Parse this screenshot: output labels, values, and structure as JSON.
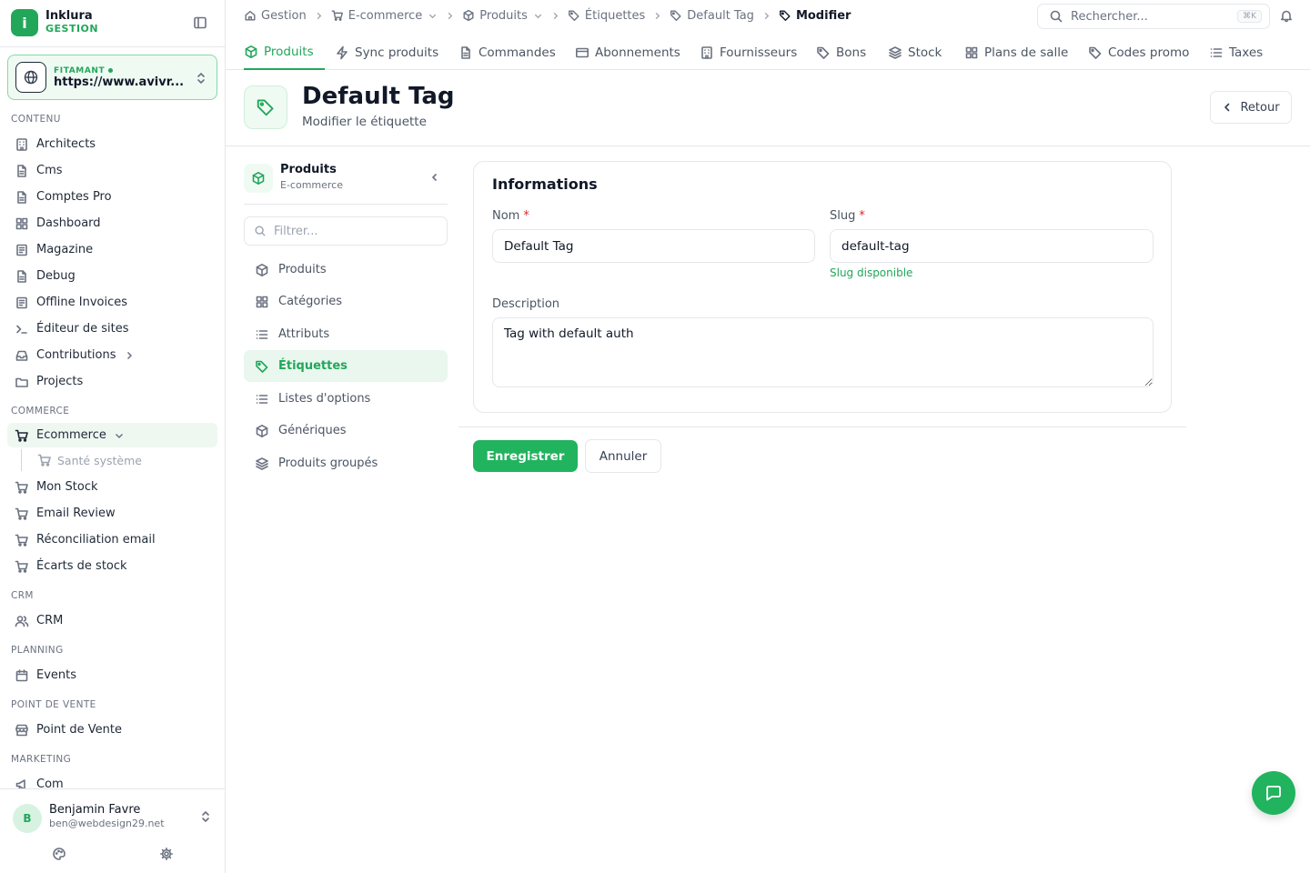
{
  "brand": {
    "name": "Inklura",
    "sub": "GESTION",
    "logo_icon": "info-icon"
  },
  "site": {
    "tag": "FITAMANT",
    "url": "https://www.avivr..."
  },
  "sidebar": {
    "sections": {
      "contenu": "CONTENU",
      "commerce": "COMMERCE",
      "crm": "CRM",
      "planning": "PLANNING",
      "pos": "POINT DE VENTE",
      "marketing": "MARKETING"
    },
    "items": {
      "architects": "Architects",
      "cms": "Cms",
      "comptes_pro": "Comptes Pro",
      "dashboard": "Dashboard",
      "magazine": "Magazine",
      "debug": "Debug",
      "offline_invoices": "Offline Invoices",
      "editeur": "Éditeur de sites",
      "contributions": "Contributions",
      "projects": "Projects",
      "ecommerce": "Ecommerce",
      "sante": "Santé système",
      "mon_stock": "Mon Stock",
      "email_review": "Email Review",
      "reconciliation": "Réconciliation email",
      "ecarts": "Écarts de stock",
      "crm": "CRM",
      "events": "Events",
      "pos": "Point de Vente",
      "com": "Com"
    }
  },
  "user": {
    "initial": "B",
    "name": "Benjamin Favre",
    "email": "ben@webdesign29.net"
  },
  "breadcrumb": {
    "gestion": "Gestion",
    "ecommerce": "E-commerce",
    "produits": "Produits",
    "etiquettes": "Étiquettes",
    "tag": "Default Tag",
    "current": "Modifier"
  },
  "search": {
    "placeholder": "Rechercher...",
    "shortcut": "⌘K"
  },
  "tabs": {
    "produits": "Produits",
    "sync": "Sync produits",
    "commandes": "Commandes",
    "abonnements": "Abonnements",
    "fournisseurs": "Fournisseurs",
    "bons": "Bons",
    "stock": "Stock",
    "plans": "Plans de salle",
    "codes": "Codes promo",
    "taxes": "Taxes"
  },
  "page": {
    "title": "Default Tag",
    "subtitle": "Modifier le étiquette",
    "back_label": "Retour"
  },
  "subnav": {
    "title": "Produits",
    "subtitle": "E-commerce",
    "filter_placeholder": "Filtrer...",
    "items": {
      "produits": "Produits",
      "categories": "Catégories",
      "attributs": "Attributs",
      "etiquettes": "Étiquettes",
      "listes": "Listes d'options",
      "generiques": "Génériques",
      "groupes": "Produits groupés"
    }
  },
  "form": {
    "title": "Informations",
    "name_label": "Nom",
    "name_value": "Default Tag",
    "slug_label": "Slug",
    "slug_value": "default-tag",
    "slug_status": "Slug disponible",
    "desc_label": "Description",
    "desc_value": "Tag with default auth",
    "required_mark": "*",
    "save_label": "Enregistrer",
    "cancel_label": "Annuler"
  },
  "colors": {
    "accent": "#22a75a",
    "accent_bg": "#effaf3",
    "required": "#dc2626",
    "border": "#e5e7eb"
  }
}
